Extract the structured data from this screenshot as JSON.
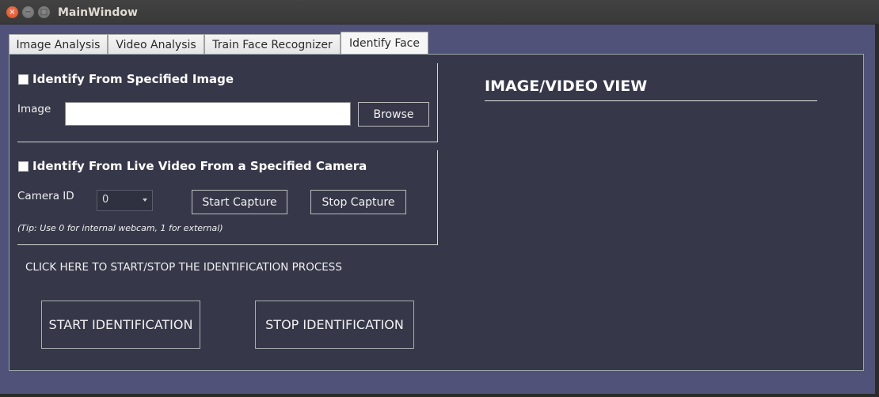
{
  "window": {
    "title": "MainWindow",
    "controls": {
      "close": "×",
      "minimize": "−",
      "maximize": "□"
    }
  },
  "tabs": [
    {
      "label": "Image Analysis",
      "active": false
    },
    {
      "label": "Video Analysis",
      "active": false
    },
    {
      "label": "Train Face Recognizer",
      "active": false
    },
    {
      "label": "Identify Face",
      "active": true
    }
  ],
  "image_group": {
    "checkbox_label": "Identify From Specified Image",
    "checked": false,
    "image_label": "Image",
    "image_value": "",
    "browse_label": "Browse"
  },
  "camera_group": {
    "checkbox_label": "Identify From Live Video From a Specified Camera",
    "checked": false,
    "camera_label": "Camera ID",
    "camera_value": "0",
    "start_capture_label": "Start Capture",
    "stop_capture_label": "Stop Capture",
    "tip": "(Tip: Use 0 for internal webcam, 1 for external)"
  },
  "identification": {
    "instruction": "CLICK HERE TO START/STOP THE IDENTIFICATION PROCESS",
    "start_label": "START IDENTIFICATION",
    "stop_label": "STOP IDENTIFICATION"
  },
  "view": {
    "title": "IMAGE/VIDEO VIEW"
  },
  "colors": {
    "window_bg": "#51527a",
    "pane_bg": "#363849",
    "titlebar_bg": "#3c3c3c",
    "close_button": "#e95420"
  }
}
